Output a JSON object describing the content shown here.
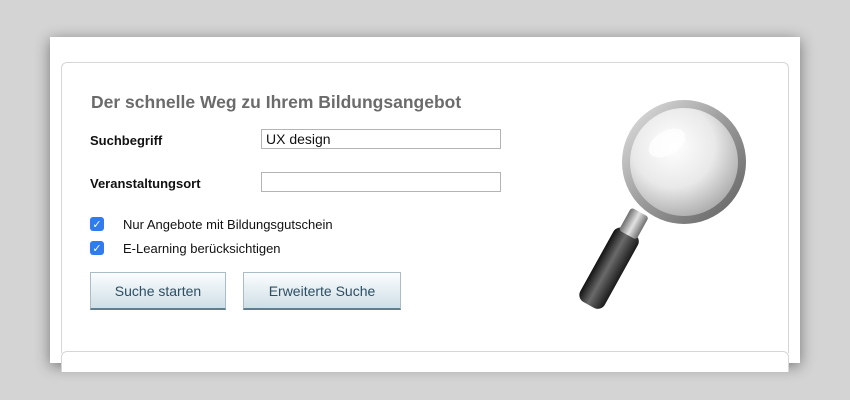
{
  "form": {
    "title": "Der schnelle Weg zu Ihrem Bildungsangebot",
    "search_term_label": "Suchbegriff",
    "search_term_value": "UX design",
    "location_label": "Veranstaltungsort",
    "location_value": "",
    "checkboxes": [
      {
        "label": "Nur Angebote mit Bildungsgutschein",
        "checked": true
      },
      {
        "label": "E-Learning berücksichtigen",
        "checked": true
      }
    ],
    "start_button_label": "Suche starten",
    "advanced_button_label": "Erweiterte Suche"
  },
  "icons": {
    "illustration": "magnifying-glass-icon",
    "checkmark": "checkmark-icon"
  },
  "colors": {
    "page_background": "#d4d4d4",
    "title_text": "#6b6b6b",
    "checkbox_fill": "#2f7bf0",
    "button_text": "#2c4f63",
    "magnifier_rim": "#a8a8a8",
    "magnifier_handle": "#2a2a2a"
  }
}
